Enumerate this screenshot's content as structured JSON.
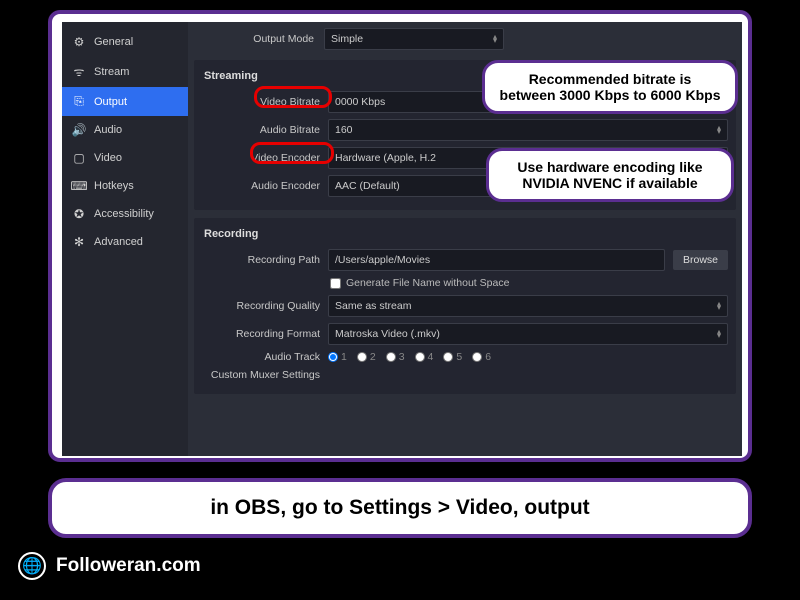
{
  "sidebar": [
    {
      "icon": "⚙",
      "label": "General"
    },
    {
      "icon": "ᯤ",
      "label": "Stream"
    },
    {
      "icon": "⎘",
      "label": "Output",
      "active": true
    },
    {
      "icon": "🔊",
      "label": "Audio"
    },
    {
      "icon": "▢",
      "label": "Video"
    },
    {
      "icon": "⌨",
      "label": "Hotkeys"
    },
    {
      "icon": "✪",
      "label": "Accessibility"
    },
    {
      "icon": "✻",
      "label": "Advanced"
    }
  ],
  "outputMode": {
    "label": "Output Mode",
    "value": "Simple"
  },
  "streaming": {
    "title": "Streaming",
    "videoBitrate": {
      "label": "Video Bitrate",
      "value": "0000 Kbps"
    },
    "audioBitrate": {
      "label": "Audio Bitrate",
      "value": "160"
    },
    "videoEncoder": {
      "label": "Video Encoder",
      "value": "Hardware (Apple, H.2"
    },
    "audioEncoder": {
      "label": "Audio Encoder",
      "value": "AAC (Default)"
    }
  },
  "recording": {
    "title": "Recording",
    "path": {
      "label": "Recording Path",
      "value": "/Users/apple/Movies",
      "browse": "Browse"
    },
    "genFilename": "Generate File Name without Space",
    "quality": {
      "label": "Recording Quality",
      "value": "Same as stream"
    },
    "format": {
      "label": "Recording Format",
      "value": "Matroska Video (.mkv)"
    },
    "audioTrack": {
      "label": "Audio Track",
      "tracks": [
        "1",
        "2",
        "3",
        "4",
        "5",
        "6"
      ]
    },
    "muxer": {
      "label": "Custom Muxer Settings"
    }
  },
  "callouts": {
    "bitrate": "Recommended bitrate is between 3000 Kbps to 6000 Kbps",
    "encoder": "Use hardware encoding like NVIDIA NVENC if available"
  },
  "instruction": "in OBS, go to Settings > Video, output",
  "brand": "Followeran.com"
}
